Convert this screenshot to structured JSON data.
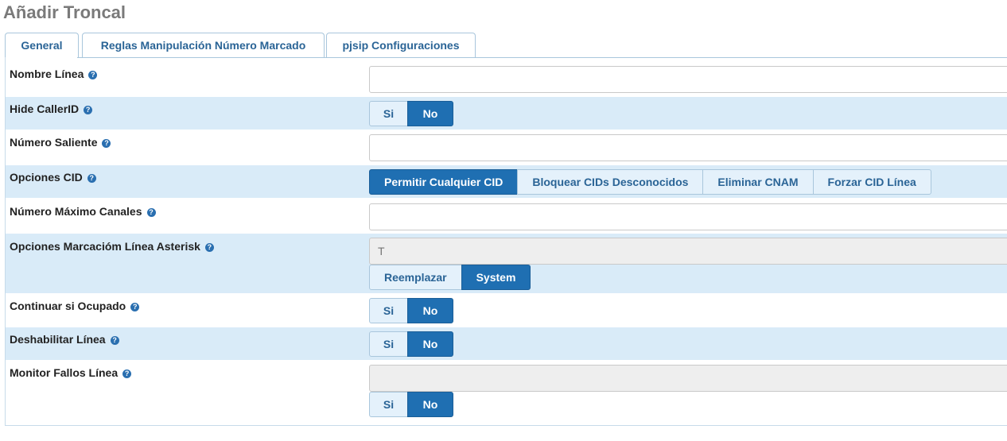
{
  "page": {
    "title": "Añadir Troncal"
  },
  "tabs": [
    {
      "label": "General",
      "active": true
    },
    {
      "label": "Reglas Manipulación Número Marcado",
      "active": false
    },
    {
      "label": "pjsip Configuraciones",
      "active": false
    }
  ],
  "form": {
    "nombre_linea": {
      "label": "Nombre Línea",
      "value": ""
    },
    "hide_callerid": {
      "label": "Hide CallerID",
      "options": [
        "Si",
        "No"
      ],
      "selected": "No"
    },
    "numero_saliente": {
      "label": "Número Saliente",
      "value": ""
    },
    "opciones_cid": {
      "label": "Opciones CID",
      "options": [
        "Permitir Cualquier CID",
        "Bloquear CIDs Desconocidos",
        "Eliminar CNAM",
        "Forzar CID Línea"
      ],
      "selected": "Permitir Cualquier CID"
    },
    "numero_maximo_canales": {
      "label": "Número Máximo Canales",
      "value": ""
    },
    "opciones_marcacion": {
      "label": "Opciones Marcacióm Línea Asterisk",
      "placeholder": "T",
      "options": [
        "Reemplazar",
        "System"
      ],
      "selected": "System"
    },
    "continuar_ocupado": {
      "label": "Continuar si Ocupado",
      "options": [
        "Si",
        "No"
      ],
      "selected": "No"
    },
    "deshabilitar_linea": {
      "label": "Deshabilitar Línea",
      "options": [
        "Si",
        "No"
      ],
      "selected": "No"
    },
    "monitor_fallos": {
      "label": "Monitor Fallos Línea",
      "value": "",
      "options": [
        "Si",
        "No"
      ],
      "selected": "No"
    }
  },
  "icons": {
    "help": "question-circle-icon"
  },
  "colors": {
    "accent": "#1f6fb2",
    "row_shade": "#d9ebf8",
    "link": "#2a6496"
  }
}
